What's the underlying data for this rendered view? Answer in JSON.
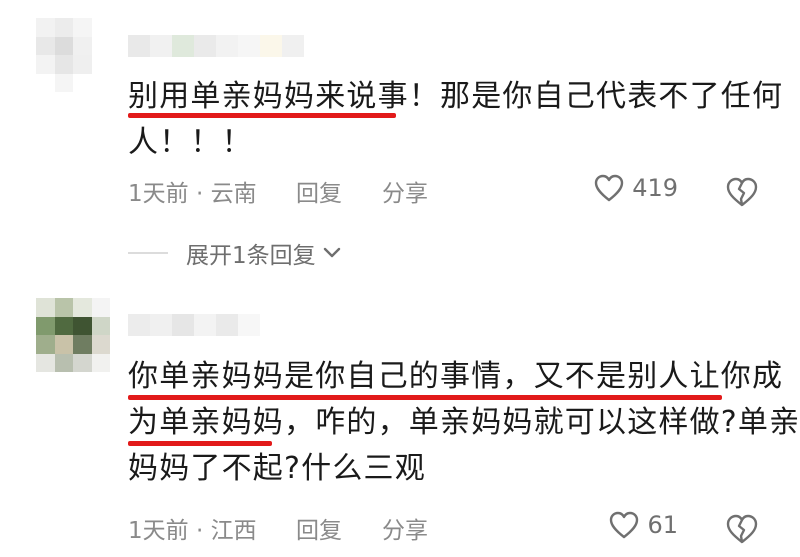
{
  "comments": [
    {
      "text_lines": [
        "别用单亲妈妈来说事！那是你自己代表不了任何",
        "人！！！"
      ],
      "time": "1天前",
      "location": "云南",
      "meta_separator": " · ",
      "reply_label": "回复",
      "share_label": "分享",
      "like_count": "419",
      "icons": {
        "like": "heart-icon",
        "dislike": "broken-heart-icon"
      },
      "avatar_colors": [
        "#f2f2f2",
        "#ececec",
        "#f5f5f5",
        "#ffffff",
        "#e8e8e8",
        "#dcdcdc",
        "#f0f0f0",
        "#ffffff",
        "#f3f3f3",
        "#e6e6e6",
        "#efefef",
        "#ffffff",
        "#ffffff",
        "#f5f5f5",
        "#ffffff",
        "#ffffff"
      ],
      "username_blur_colors": [
        "#e9e9e9",
        "#f1f1f1",
        "#dfe9dc",
        "#eaeaea",
        "#f2f2f2",
        "#f6f6f6",
        "#fbf7ea",
        "#f0f0f0"
      ]
    },
    {
      "text_lines": [
        "你单亲妈妈是你自己的事情，又不是别人让你成",
        "为单亲妈妈，咋的，单亲妈妈就可以这样做?单亲",
        "妈妈了不起?什么三观"
      ],
      "time": "1天前",
      "location": "江西",
      "meta_separator": " · ",
      "reply_label": "回复",
      "share_label": "分享",
      "like_count": "61",
      "icons": {
        "like": "heart-icon",
        "dislike": "broken-heart-icon"
      },
      "avatar_colors": [
        "#dfe3d6",
        "#b9c4a8",
        "#e4e8dc",
        "#f4f4f4",
        "#7f9a6b",
        "#4f6a3e",
        "#3e5431",
        "#cfd6c6",
        "#9fae8a",
        "#c9c2a7",
        "#6f7d60",
        "#dcd9cf",
        "#e5e6e1",
        "#b8bfae",
        "#d4d6cf",
        "#f1f1ef"
      ],
      "username_blur_colors": [
        "#ececec",
        "#f0f0f0",
        "#e6e6e6",
        "#f3f3f3",
        "#eaeaea",
        "#f7f7f7"
      ]
    }
  ],
  "expand_replies_label": "展开1条回复",
  "accent_color": "#e21a1a"
}
